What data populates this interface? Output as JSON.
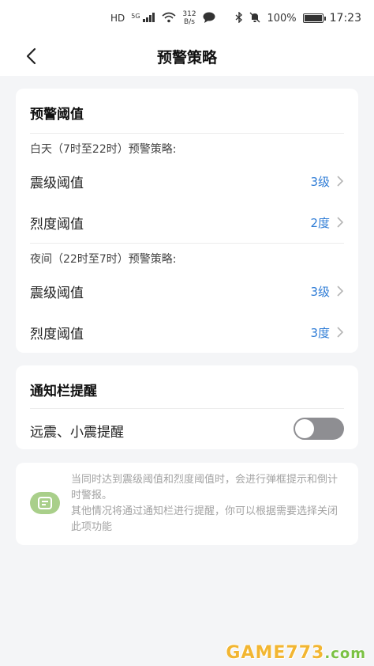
{
  "status_bar": {
    "hd": "HD",
    "signal": "5G",
    "net_speed_value": "312",
    "net_speed_unit": "B/s",
    "battery": "100%",
    "time": "17:23"
  },
  "header": {
    "title": "预警策略"
  },
  "threshold_section": {
    "title": "预警阈值",
    "day_label": "白天（7时至22时）预警策略:",
    "day_rows": [
      {
        "label": "震级阈值",
        "value": "3级"
      },
      {
        "label": "烈度阈值",
        "value": "2度"
      }
    ],
    "night_label": "夜间（22时至7时）预警策略:",
    "night_rows": [
      {
        "label": "震级阈值",
        "value": "3级"
      },
      {
        "label": "烈度阈值",
        "value": "3度"
      }
    ]
  },
  "notify_section": {
    "title": "通知栏提醒",
    "toggle_label": "远震、小震提醒",
    "toggle_on": false
  },
  "note": {
    "line1": "当同时达到震级阈值和烈度阈值时，会进行弹框提示和倒计时警报。",
    "line2": "其他情况将通过通知栏进行提醒，你可以根据需要选择关闭此项功能"
  },
  "watermark": {
    "main": "GAME773",
    "suffix": ".com"
  },
  "colors": {
    "accent_blue": "#2e7cd6",
    "toggle_off": "#8e8e92",
    "note_icon": "#a9cf8a"
  }
}
